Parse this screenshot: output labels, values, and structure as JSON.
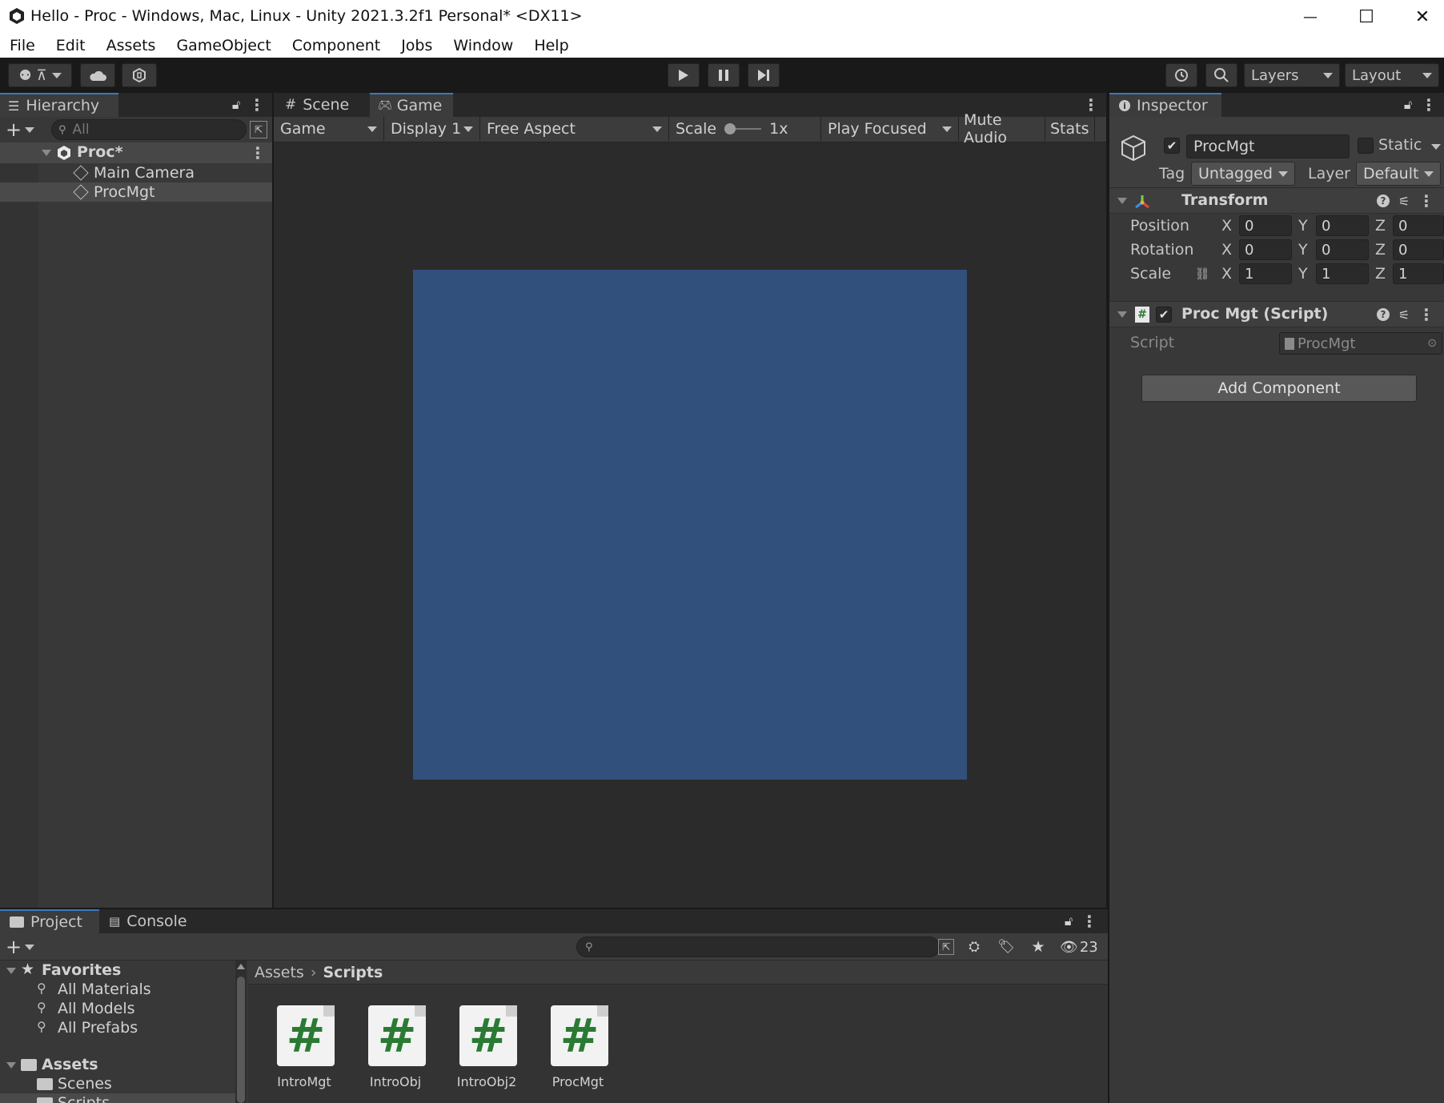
{
  "window": {
    "title": "Hello - Proc - Windows, Mac, Linux - Unity 2021.3.2f1 Personal* <DX11>",
    "minimize": "—",
    "maximize": "☐",
    "close": "✕"
  },
  "menu": [
    "File",
    "Edit",
    "Assets",
    "GameObject",
    "Component",
    "Jobs",
    "Window",
    "Help"
  ],
  "toolbar": {
    "account_label": "⚉ ⊼",
    "layers": "Layers",
    "layout": "Layout"
  },
  "hierarchy": {
    "tab": "Hierarchy",
    "search_placeholder": "All",
    "scene": "Proc*",
    "items": [
      "Main Camera",
      "ProcMgt"
    ]
  },
  "center": {
    "tabs": [
      "Scene",
      "Game"
    ],
    "game_dropdown": "Game",
    "display": "Display 1",
    "aspect": "Free Aspect",
    "scale_label": "Scale",
    "scale_value": "1x",
    "play_mode": "Play Focused",
    "mute": "Mute Audio",
    "stats": "Stats",
    "viewport_color": "#31507c"
  },
  "inspector": {
    "tab": "Inspector",
    "object_name": "ProcMgt",
    "static": "Static",
    "tag_label": "Tag",
    "tag_value": "Untagged",
    "layer_label": "Layer",
    "layer_value": "Default",
    "transform": {
      "title": "Transform",
      "rows": [
        {
          "label": "Position",
          "x": "0",
          "y": "0",
          "z": "0"
        },
        {
          "label": "Rotation",
          "x": "0",
          "y": "0",
          "z": "0"
        },
        {
          "label": "Scale",
          "x": "1",
          "y": "1",
          "z": "1"
        }
      ]
    },
    "script_component": {
      "title": "Proc Mgt (Script)",
      "script_label": "Script",
      "script_value": "ProcMgt"
    },
    "add_component": "Add Component"
  },
  "project": {
    "tabs": [
      "Project",
      "Console"
    ],
    "hidden_count": "23",
    "favorites": {
      "label": "Favorites",
      "items": [
        "All Materials",
        "All Models",
        "All Prefabs"
      ]
    },
    "assets": {
      "label": "Assets",
      "items": [
        "Scenes",
        "Scripts"
      ]
    },
    "breadcrumb": [
      "Assets",
      "Scripts"
    ],
    "files": [
      "IntroMgt",
      "IntroObj",
      "IntroObj2",
      "ProcMgt"
    ]
  }
}
